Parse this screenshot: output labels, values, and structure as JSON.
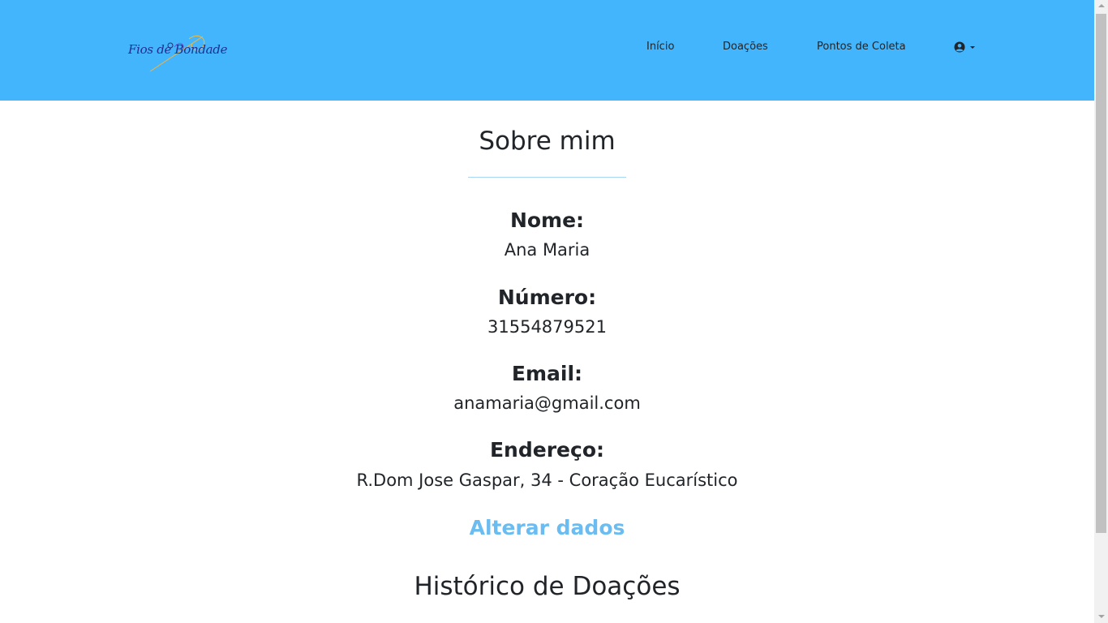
{
  "brand": {
    "logo_text": "Fios de Bondade"
  },
  "nav": {
    "inicio": "Início",
    "doacoes": "Doações",
    "pontos": "Pontos de Coleta",
    "user_icon": "user-circle-icon"
  },
  "about": {
    "title": "Sobre mim",
    "fields": [
      {
        "label": "Nome:",
        "value": "Ana Maria"
      },
      {
        "label": "Número:",
        "value": "31554879521"
      },
      {
        "label": "Email:",
        "value": "anamaria@gmail.com"
      },
      {
        "label": "Endereço:",
        "value": "R.Dom Jose Gaspar, 34 - Coração Eucarístico"
      }
    ],
    "edit_label": "Alterar dados"
  },
  "history": {
    "title": "Histórico de Doações"
  },
  "colors": {
    "navbar": "#42b5fc",
    "accent": "#6bbcf1",
    "text": "#212529"
  }
}
